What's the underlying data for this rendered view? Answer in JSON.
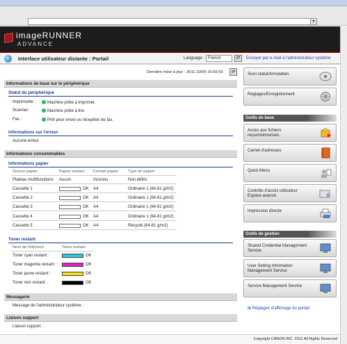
{
  "window": {
    "url_dropdown_value": "",
    "brand_line1": "imageRUNNER",
    "brand_line2": "ADVANCE"
  },
  "header": {
    "title": "Interface utilisateur distante : Portail",
    "language_label": "Language :",
    "language_value": "French",
    "language_button": "⇄",
    "mail_link": "Envoyer par e-mail à l'administrateur système"
  },
  "main": {
    "last_update": "Dernière mise à jour : 2011 10/05 16:56:55",
    "refresh_button": "⇄",
    "device_section": "Informations de base sur le périphérique",
    "status_title": "Statut du périphérique",
    "status_rows": [
      {
        "label": "Imprimante :",
        "value": "Machine prête à imprimer."
      },
      {
        "label": "Scanner :",
        "value": "Machine prête à lire."
      },
      {
        "label": "Fax :",
        "value": "Prêt pour envoi ou réception de fax."
      }
    ],
    "error_title": "Informations sur l'erreur",
    "error_value": "Aucune erreur",
    "consumables_section": "Informations consommables",
    "paper_title": "Informations papier",
    "paper_headers": [
      "Source papier",
      "Papier restant",
      "Format papier",
      "Type de papier"
    ],
    "paper_rows": [
      {
        "source": "Plateau multifonctions",
        "remaining": "Aucun",
        "size": "Inconnu",
        "type": "Non défini"
      },
      {
        "source": "Cassette 1",
        "remaining": "OK",
        "size": "A4",
        "type": "Ordinaire 1 (64-81 g/m2)"
      },
      {
        "source": "Cassette 2",
        "remaining": "OK",
        "size": "A4",
        "type": "Ordinaire 1 (64-81 g/m2)"
      },
      {
        "source": "Cassette 3",
        "remaining": "OK",
        "size": "A4",
        "type": "Ordinaire 1 (64-81 g/m2)"
      },
      {
        "source": "Cassette 4",
        "remaining": "OK",
        "size": "A4",
        "type": "Ordinaire 1 (64-81 g/m2)"
      },
      {
        "source": "Cassette 5",
        "remaining": "OK",
        "size": "A4",
        "type": "Recyclé (64-81 g/m2)"
      }
    ],
    "toner_title": "Toner restant",
    "toner_headers": [
      "Nom de l'élément",
      "Toner restant"
    ],
    "toner_rows": [
      {
        "name": "Toner cyan restant :",
        "status": "OK",
        "color": "#28c8e0"
      },
      {
        "name": "Toner magenta restant :",
        "status": "OK",
        "color": "#e020c8"
      },
      {
        "name": "Toner jaune restant :",
        "status": "OK",
        "color": "#f0e020"
      },
      {
        "name": "Toner noir restant :",
        "status": "OK",
        "color": "#000000"
      }
    ],
    "messaging_section": "Messagerie",
    "admin_message": "Message de l'administrateur système :",
    "support_section": "Liaison support",
    "support_label": "Liaison support :"
  },
  "sidebar": {
    "top_buttons": [
      {
        "label": "Suivi statut/Annulation",
        "icon": "eye-icon"
      },
      {
        "label": "Réglages/Enregistrement",
        "icon": "settings-icon"
      }
    ],
    "basic_tools_title": "Outils de base",
    "basic_tools": [
      {
        "label": "Accès aux fichiers reçus/mémorisés",
        "icon": "box-icon"
      },
      {
        "label": "Carnet d'adresses",
        "icon": "address-book-icon"
      },
      {
        "label": "Quick Menu",
        "icon": "quick-menu-icon"
      },
      {
        "label": "Contrôle d'accès utilisateur Espace avancé",
        "icon": "folder-access-icon"
      },
      {
        "label": "Impression directe",
        "icon": "printer-icon"
      }
    ],
    "management_title": "Outils de gestion",
    "management_tools": [
      {
        "label": "Shared Credential Management Service",
        "icon": "monitor-icon"
      },
      {
        "label": "User Setting Information Management Service",
        "icon": "monitor-icon"
      },
      {
        "label": "Service Management Service",
        "icon": "monitor-icon"
      }
    ],
    "portal_link": "Réglages d'affichage du portail"
  },
  "footer": {
    "copyright": "Copyright CANON INC. 2011 All Rights Reserved"
  }
}
